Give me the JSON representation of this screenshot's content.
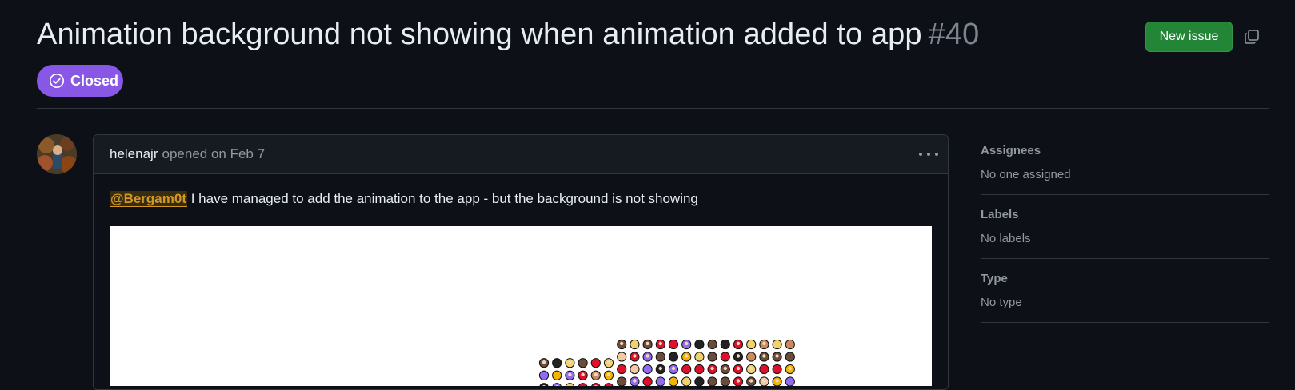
{
  "issue": {
    "title": "Animation background not showing when animation added to app",
    "number": "#40",
    "state": "Closed",
    "state_color": "#8957e5"
  },
  "header": {
    "new_issue_label": "New issue",
    "new_issue_color": "#238636"
  },
  "comment": {
    "author": "helenajr",
    "meta": "opened on Feb 7",
    "mention": "@Bergam0t",
    "body": "I have managed to add the animation to the app - but the background is not showing"
  },
  "sidebar": {
    "assignees": {
      "heading": "Assignees",
      "value": "No one assigned"
    },
    "labels": {
      "heading": "Labels",
      "value": "No labels"
    },
    "type": {
      "heading": "Type",
      "value": "No type"
    }
  }
}
